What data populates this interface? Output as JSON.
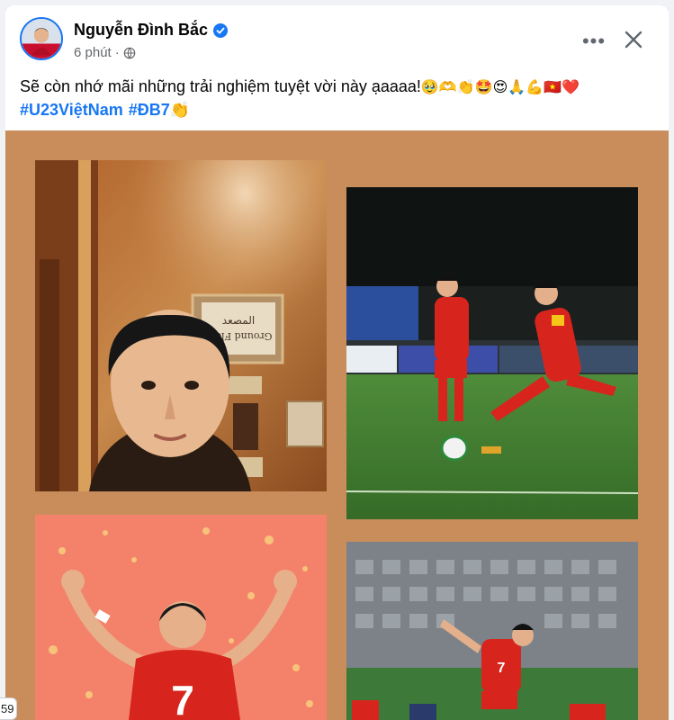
{
  "post": {
    "author": "Nguyễn Đình Bắc",
    "time": "6 phút",
    "separator": "·",
    "text": "Sẽ còn nhớ mãi những trải nghiệm tuyệt vời này ạaaaa!",
    "emojis": "🥹🫶👏🤩😍🙏💪🇻🇳❤️",
    "hashtags": [
      "#U23ViệtNam",
      "#ĐB7👏"
    ],
    "more_label": "•••"
  },
  "icons": {
    "verified": "verified-badge-icon",
    "audience": "globe-icon",
    "close": "close-icon",
    "more": "more-options-icon"
  },
  "photos": {
    "photo_1": "selfie",
    "photo_2": "football-match-kick",
    "photo_3": "illustration-player-7",
    "photo_4": "football-match-header"
  },
  "photo_texts": {
    "sign_line_1": "المصعد",
    "sign_line_2": "Ground Floor",
    "jersey_number": "7"
  },
  "edge_badge": "59",
  "colors": {
    "brand_blue": "#1877f2",
    "grid_background": "#c98d5c",
    "illustration_bg": "#f4826a",
    "jersey_red": "#d7251d"
  }
}
